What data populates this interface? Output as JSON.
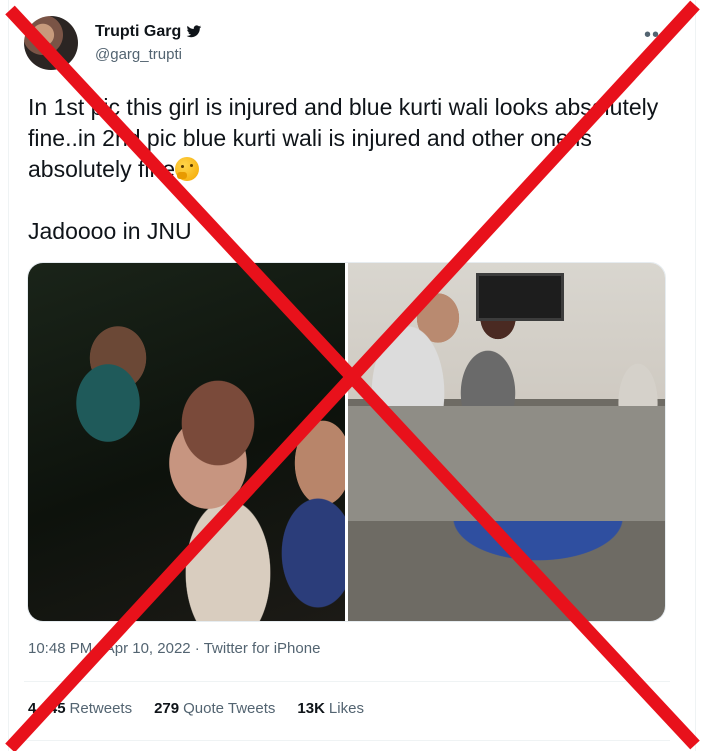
{
  "author": {
    "name": "Trupti Garg",
    "handle": "@garg_trupti",
    "verified_icon": "twitter-bird-icon"
  },
  "tweet": {
    "text": "In 1st pic this girl is injured and blue kurti wali looks absolutely fine..in 2nd pic blue kurti wali is injured and other one is absolutely fine",
    "emoji": "thinking-face-emoji",
    "text2": "Jadoooo in JNU"
  },
  "meta": {
    "time": "10:48 PM",
    "separator": " · ",
    "date": "Apr 10, 2022",
    "source": "Twitter for iPhone"
  },
  "stats": {
    "retweets_count": "4,445",
    "retweets_label": "Retweets",
    "quotes_count": "279",
    "quotes_label": "Quote Tweets",
    "likes_count": "13K",
    "likes_label": "Likes"
  },
  "more_icon": "more-options-icon",
  "overlay": {
    "color": "#e8111b",
    "icon": "red-x-cross-icon"
  }
}
